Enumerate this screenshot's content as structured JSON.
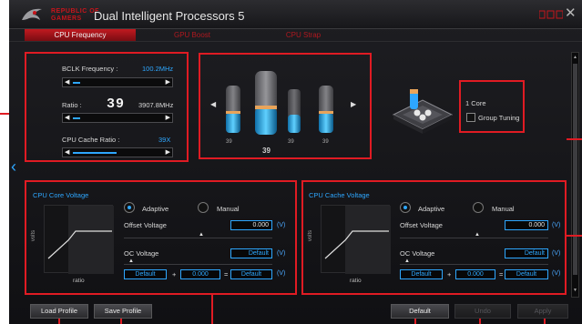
{
  "window": {
    "brand_line1": "REPUBLIC OF",
    "brand_line2": "GAMERS",
    "title": "Dual Intelligent Processors 5",
    "close_glyph": "✕"
  },
  "tabs": [
    {
      "label": "CPU Frequency",
      "active": true
    },
    {
      "label": "GPU Boost",
      "active": false
    },
    {
      "label": "CPU Strap",
      "active": false
    }
  ],
  "frequency": {
    "bclk_label": "BCLK Frequency :",
    "bclk_value": "100.2MHz",
    "ratio_label": "Ratio :",
    "ratio_value": "39",
    "ratio_freq": "3907.8MHz",
    "cache_label": "CPU Cache Ratio :",
    "cache_value": "39X",
    "bclk_level": 0.08,
    "ratio_level": 0.08,
    "cache_level": 0.5
  },
  "cores": {
    "labels": [
      "39",
      "39",
      "39",
      "39"
    ],
    "arrow_left": "◀",
    "arrow_right": "▶"
  },
  "core_mode": {
    "label": "1 Core",
    "group_tuning": "Group Tuning",
    "group_tuning_checked": false
  },
  "core_voltage": {
    "title": "CPU Core Voltage",
    "adaptive": "Adaptive",
    "manual": "Manual",
    "offset_label": "Offset Voltage",
    "offset_value": "0.000",
    "unit": "(V)",
    "oc_label": "OC Voltage",
    "oc_value": "Default",
    "y_axis": "volts",
    "x_axis": "ratio",
    "sum_a": "Default",
    "plus": "+",
    "sum_b": "0.000",
    "equals": "=",
    "sum_result": "Default"
  },
  "cache_voltage": {
    "title": "CPU Cache Voltage",
    "adaptive": "Adaptive",
    "manual": "Manual",
    "offset_label": "Offset Voltage",
    "offset_value": "0.000",
    "unit": "(V)",
    "oc_label": "OC Voltage",
    "oc_value": "Default",
    "y_axis": "volts",
    "x_axis": "ratio",
    "sum_a": "Default",
    "plus": "+",
    "sum_b": "0.000",
    "equals": "=",
    "sum_result": "Default"
  },
  "buttons": {
    "load_profile": "Load Profile",
    "save_profile": "Save Profile",
    "default": "Default",
    "undo": "Undo",
    "apply": "Apply"
  },
  "nav": {
    "left_arrow": "‹"
  },
  "colors": {
    "accent": "#2ea7ff",
    "highlight": "#e01b23",
    "brand": "#c7151b"
  }
}
